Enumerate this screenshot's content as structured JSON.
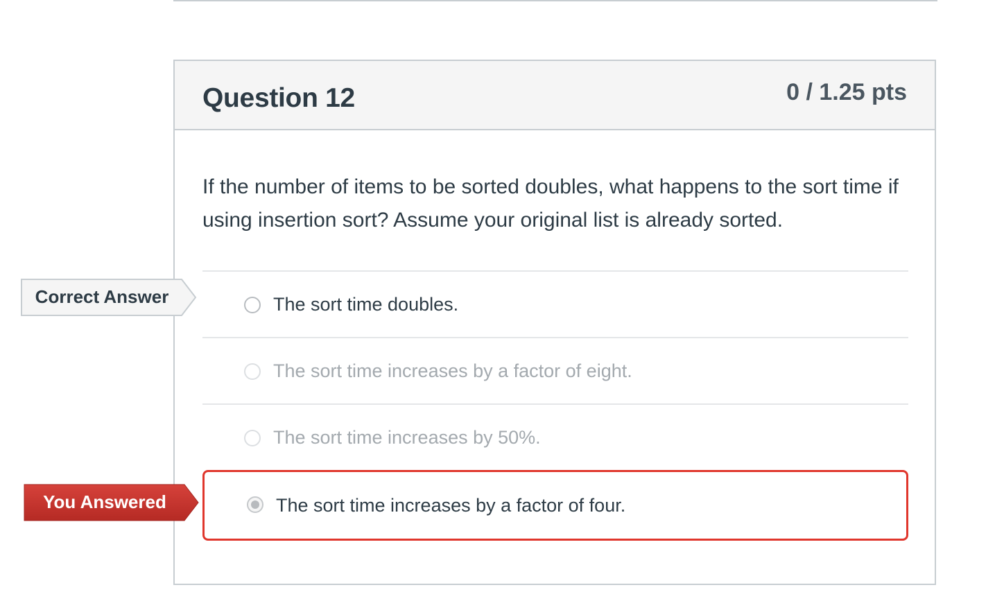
{
  "question": {
    "title": "Question 12",
    "points": "0 / 1.25 pts",
    "text": "If the number of items to be sorted doubles, what happens to the sort time if using insertion sort?  Assume your original list is already sorted."
  },
  "answers": [
    {
      "label": "The sort time doubles.",
      "state": "correct"
    },
    {
      "label": "The sort time increases by a factor of eight.",
      "state": "unselected"
    },
    {
      "label": "The sort time increases by 50%.",
      "state": "unselected"
    },
    {
      "label": "The sort time increases by a factor of four.",
      "state": "selected"
    }
  ],
  "flags": {
    "correct_answer": "Correct Answer",
    "you_answered": "You Answered"
  },
  "colors": {
    "selected_border": "#e0362c",
    "you_answered_flag": "#c9302c",
    "correct_flag": "#f5f5f5"
  }
}
